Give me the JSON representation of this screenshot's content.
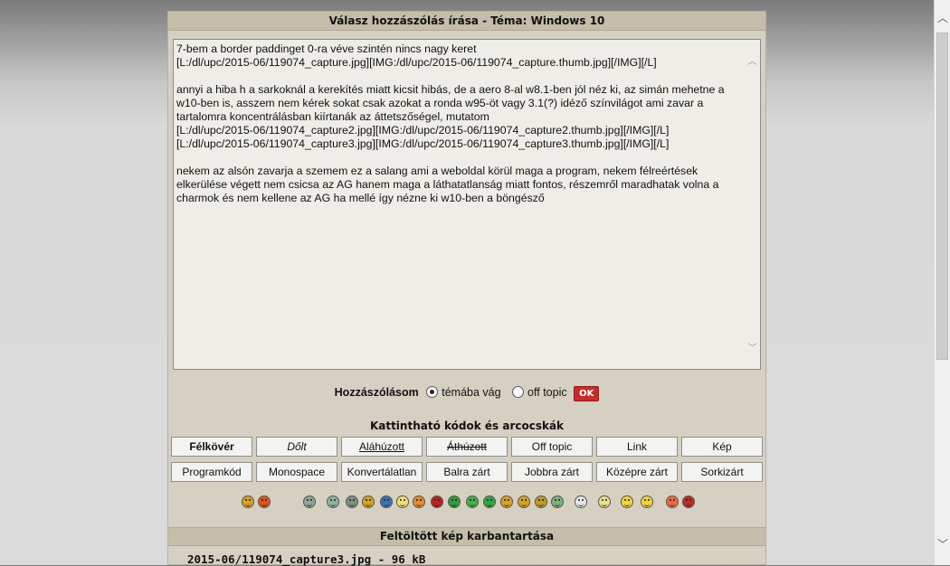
{
  "panel": {
    "title": "Válasz hozzászólás írása - Téma: Windows 10"
  },
  "editor": {
    "text": "7-bem a border paddinget 0-ra véve szintén nincs nagy keret\n[L:/dl/upc/2015-06/119074_capture.jpg][IMG:/dl/upc/2015-06/119074_capture.thumb.jpg][/IMG][/L]\n\nannyi a hiba h a sarkoknál a kerekítés miatt kicsit hibás, de a aero 8-al w8.1-ben jól néz ki, az simán mehetne a w10-ben is, asszem nem kérek sokat csak azokat a ronda w95-öt vagy 3.1(?) idéző színvilágot ami zavar a tartalomra koncentrálásban kiírtanák az áttetszőségel, mutatom\n[L:/dl/upc/2015-06/119074_capture2.jpg][IMG:/dl/upc/2015-06/119074_capture2.thumb.jpg][/IMG][/L]\n[L:/dl/upc/2015-06/119074_capture3.jpg][IMG:/dl/upc/2015-06/119074_capture3.thumb.jpg][/IMG][/L]\n\nnekem az alsón zavarja a szemem ez a salang ami a weboldal körül maga a program, nekem félreértések elkerülése végett nem csicsa az AG hanem maga a láthatatlanság miatt fontos, részemről maradhatak volna a charmok és nem kellene az AG ha mellé így nézne ki w10-ben a böngésző"
  },
  "post_type": {
    "label": "Hozzászólásom",
    "option_on_topic": "témába vág",
    "option_off_topic": "off topic",
    "selected": "témába vág",
    "ok_label": "OK"
  },
  "codes": {
    "title": "Kattintható kódok és arcocskák",
    "row1": [
      "Félkövér",
      "Dőlt",
      "Aláhúzott",
      "Áthúzott",
      "Off topic",
      "Link",
      "Kép"
    ],
    "row2": [
      "Programkód",
      "Monospace",
      "Konvertálatlan",
      "Balra zárt",
      "Jobbra zárt",
      "Középre zárt",
      "Sorkizárt"
    ]
  },
  "smileys": [
    {
      "icon": "smile-icon",
      "color": "#d8a324"
    },
    {
      "icon": "angry-icon",
      "color": "#e2521d"
    },
    {
      "icon": "grin-icon",
      "color": "#8fa59a"
    },
    {
      "icon": "happy-icon",
      "color": "#8fb3a0"
    },
    {
      "icon": "teeth-icon",
      "color": "#7e8f84"
    },
    {
      "icon": "neutral-icon",
      "color": "#d8a324"
    },
    {
      "icon": "sad-icon",
      "color": "#3f6fb8"
    },
    {
      "icon": "confused-icon",
      "color": "#efe07a"
    },
    {
      "icon": "shy-icon",
      "color": "#e98b2c"
    },
    {
      "icon": "red-face-icon",
      "color": "#c0201d"
    },
    {
      "icon": "sunglasses-icon",
      "color": "#2f9d3a"
    },
    {
      "icon": "sick-icon",
      "color": "#45b24b"
    },
    {
      "icon": "green-smile-icon",
      "color": "#31a843"
    },
    {
      "icon": "cheeky-icon",
      "color": "#d8a324"
    },
    {
      "icon": "wink-icon",
      "color": "#d8a324"
    },
    {
      "icon": "laugh-icon",
      "color": "#c29b23"
    },
    {
      "icon": "shocked-icon",
      "color": "#7fb27a"
    },
    {
      "icon": "skull-icon",
      "color": "#e5e5e5"
    },
    {
      "icon": "question-icon",
      "color": "#efe08a"
    },
    {
      "icon": "yellow-smile-icon",
      "color": "#f4d43b"
    },
    {
      "icon": "duck-icon",
      "color": "#f4d43b"
    },
    {
      "icon": "pacman-icon",
      "color": "#ee6b3f"
    },
    {
      "icon": "ladder-icon",
      "color": "#b92d2d"
    }
  ],
  "uploaded": {
    "title": "Feltöltött kép karbantartása",
    "file": "2015-06/119074_capture3.jpg - 96 kB"
  }
}
